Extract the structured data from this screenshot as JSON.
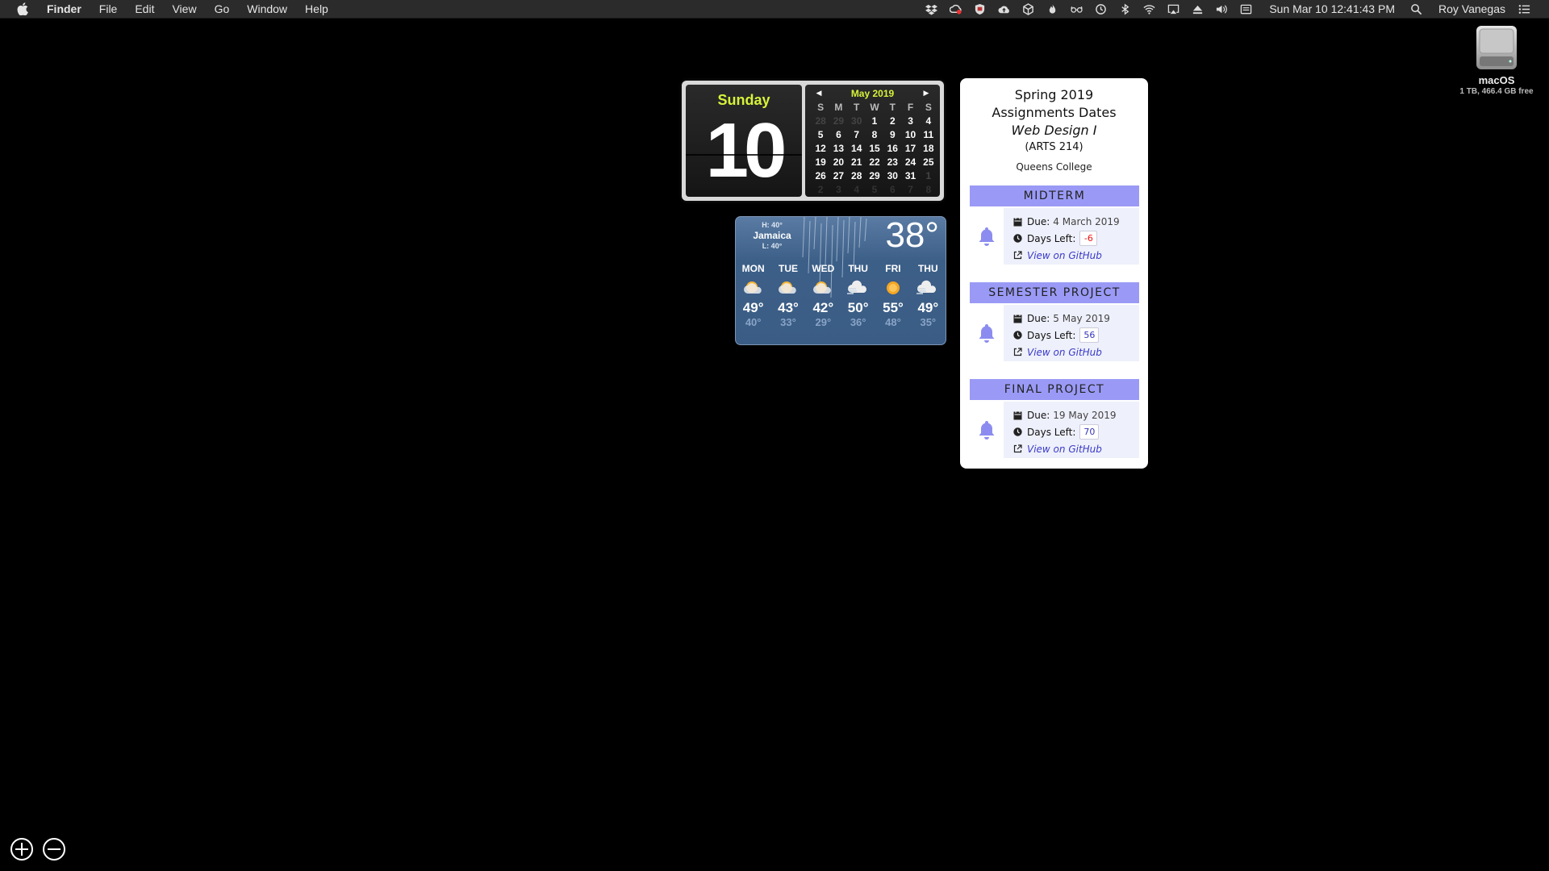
{
  "menubar": {
    "app_name": "Finder",
    "menus": [
      "File",
      "Edit",
      "View",
      "Go",
      "Window",
      "Help"
    ],
    "status_icons": [
      "dropbox-icon",
      "creative-cloud-icon",
      "shield-icon",
      "cloud-upload-icon",
      "box-icon",
      "flame-icon",
      "glasses-icon",
      "time-machine-icon",
      "bluetooth-icon",
      "wifi-icon",
      "airplay-icon",
      "eject-icon",
      "volume-icon",
      "display-icon"
    ],
    "clock": "Sun Mar 10  12:41:43 PM",
    "user": "Roy Vanegas"
  },
  "desktop": {
    "disk_name": "macOS",
    "disk_info": "1 TB, 466.4 GB free"
  },
  "calendar": {
    "day_name": "Sunday",
    "day_number": "10",
    "month_label": "May 2019",
    "weekday_headers": [
      "S",
      "M",
      "T",
      "W",
      "T",
      "F",
      "S"
    ],
    "weeks": [
      [
        {
          "d": "28",
          "dim": true
        },
        {
          "d": "29",
          "dim": true
        },
        {
          "d": "30",
          "dim": true
        },
        {
          "d": "1"
        },
        {
          "d": "2"
        },
        {
          "d": "3"
        },
        {
          "d": "4"
        }
      ],
      [
        {
          "d": "5"
        },
        {
          "d": "6"
        },
        {
          "d": "7"
        },
        {
          "d": "8"
        },
        {
          "d": "9"
        },
        {
          "d": "10"
        },
        {
          "d": "11"
        }
      ],
      [
        {
          "d": "12"
        },
        {
          "d": "13"
        },
        {
          "d": "14"
        },
        {
          "d": "15"
        },
        {
          "d": "16"
        },
        {
          "d": "17"
        },
        {
          "d": "18"
        }
      ],
      [
        {
          "d": "19"
        },
        {
          "d": "20"
        },
        {
          "d": "21"
        },
        {
          "d": "22"
        },
        {
          "d": "23"
        },
        {
          "d": "24"
        },
        {
          "d": "25"
        }
      ],
      [
        {
          "d": "26"
        },
        {
          "d": "27"
        },
        {
          "d": "28"
        },
        {
          "d": "29"
        },
        {
          "d": "30"
        },
        {
          "d": "31"
        },
        {
          "d": "1",
          "dim": true
        }
      ],
      [
        {
          "d": "2",
          "dim": true
        },
        {
          "d": "3",
          "dim": true
        },
        {
          "d": "4",
          "dim": true
        },
        {
          "d": "5",
          "dim": true
        },
        {
          "d": "6",
          "dim": true
        },
        {
          "d": "7",
          "dim": true
        },
        {
          "d": "8",
          "dim": true
        }
      ]
    ]
  },
  "weather": {
    "high": "H: 40°",
    "city": "Jamaica",
    "low": "L: 40°",
    "current_temp": "38°",
    "forecast": [
      {
        "day": "MON",
        "hi": "49°",
        "lo": "40°",
        "icon": "partly-sunny-icon"
      },
      {
        "day": "TUE",
        "hi": "43°",
        "lo": "33°",
        "icon": "partly-sunny-icon"
      },
      {
        "day": "WED",
        "hi": "42°",
        "lo": "29°",
        "icon": "partly-sunny-icon"
      },
      {
        "day": "THU",
        "hi": "50°",
        "lo": "36°",
        "icon": "windy-cloud-icon"
      },
      {
        "day": "FRI",
        "hi": "55°",
        "lo": "48°",
        "icon": "sun-icon"
      },
      {
        "day": "THU",
        "hi": "49°",
        "lo": "35°",
        "icon": "windy-cloud-icon"
      }
    ],
    "colors": {
      "low_temp": "#8aa4c7"
    }
  },
  "assignments": {
    "title_line1": "Spring 2019",
    "title_line2": "Assignments Dates",
    "course_name": "Web Design I",
    "course_code": "(ARTS 214)",
    "college": "Queens College",
    "accent_color": "#9a9af6",
    "items": [
      {
        "heading": "MIDTERM",
        "due_label": "Due:",
        "due": "4 March 2019",
        "days_label": "Days Left:",
        "days_left": "-6",
        "link": "View on GitHub"
      },
      {
        "heading": "SEMESTER PROJECT",
        "due_label": "Due:",
        "due": "5 May 2019",
        "days_label": "Days Left:",
        "days_left": "56",
        "link": "View on GitHub"
      },
      {
        "heading": "FINAL PROJECT",
        "due_label": "Due:",
        "due": "19 May 2019",
        "days_label": "Days Left:",
        "days_left": "70",
        "link": "View on GitHub"
      }
    ]
  }
}
